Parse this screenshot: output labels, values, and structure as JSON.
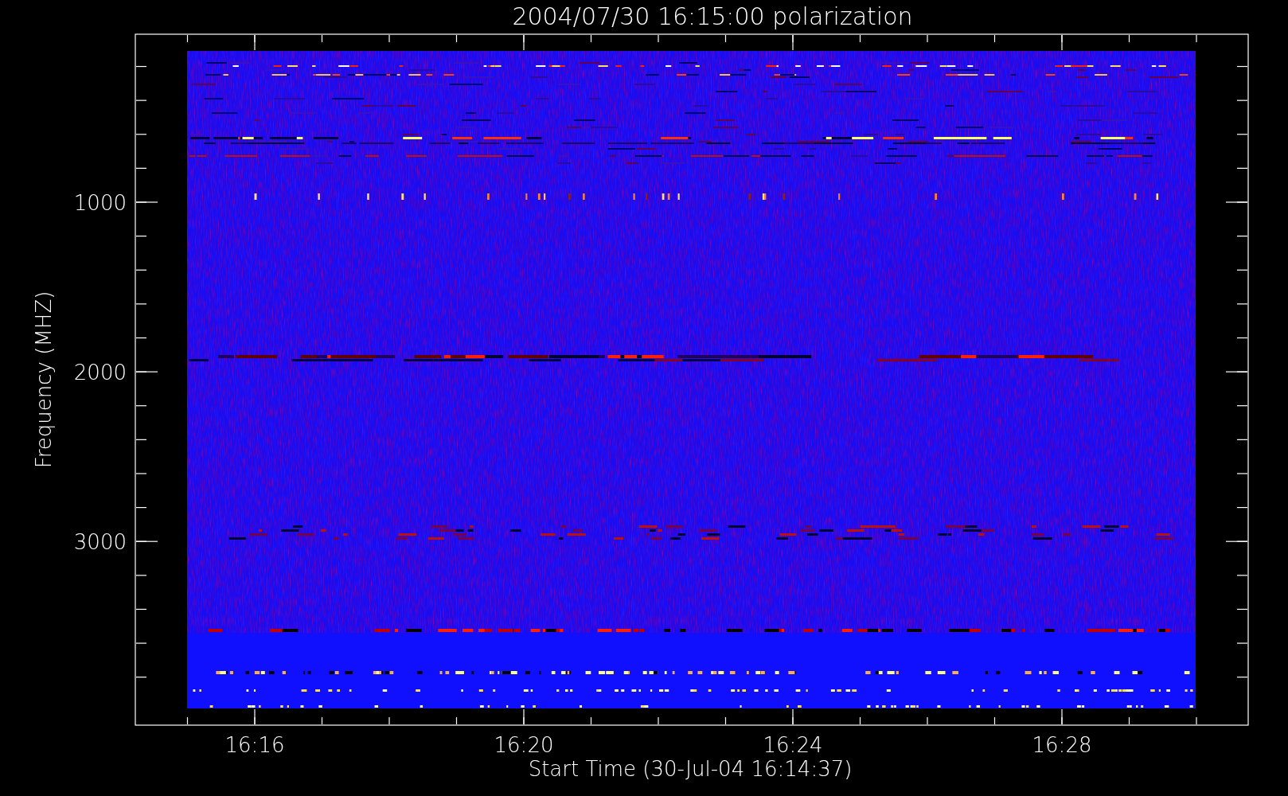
{
  "title": "2004/07/30 16:15:00 polarization",
  "ylabel": "Frequency (MHZ)",
  "xlabel": "Start Time (30-Jul-04 16:14:37)",
  "yticks": [
    "1000",
    "2000",
    "3000"
  ],
  "xticks": [
    "16:16",
    "16:20",
    "16:24",
    "16:28"
  ]
}
